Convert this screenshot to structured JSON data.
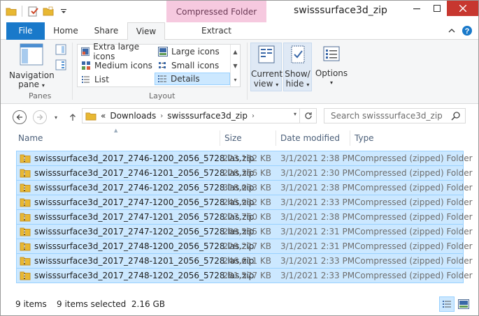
{
  "window": {
    "title": "swisssurface3d_zip",
    "context_tab_header": "Compressed Folder Tools",
    "controls": [
      "minimize-icon",
      "maximize-icon",
      "close-icon"
    ]
  },
  "ribbon_tabs": {
    "file": "File",
    "home": "Home",
    "share": "Share",
    "view": "View",
    "extract": "Extract",
    "active": "View"
  },
  "ribbon": {
    "panes": {
      "navigation_pane_line1": "Navigation",
      "navigation_pane_line2": "pane",
      "group_label": "Panes"
    },
    "layout": {
      "extra_large_icons": "Extra large icons",
      "large_icons": "Large icons",
      "medium_icons": "Medium icons",
      "small_icons": "Small icons",
      "list": "List",
      "details": "Details",
      "selected": "Details",
      "group_label": "Layout"
    },
    "current_view_line1": "Current",
    "current_view_line2": "view",
    "show_hide_line1": "Show/",
    "show_hide_line2": "hide",
    "options": "Options"
  },
  "address": {
    "prefix": "«",
    "crumbs": [
      "Downloads",
      "swisssurface3d_zip"
    ],
    "search_placeholder": "Search swisssurface3d_zip"
  },
  "columns": {
    "name": "Name",
    "size": "Size",
    "date": "Date modified",
    "type": "Type"
  },
  "files": [
    {
      "name": "swisssurface3d_2017_2746-1200_2056_5728.las.zip",
      "size": "223,182 KB",
      "date": "3/1/2021 2:38 PM",
      "type": "Compressed (zipped) Folder"
    },
    {
      "name": "swisssurface3d_2017_2746-1201_2056_5728.las.zip",
      "size": "228,356 KB",
      "date": "3/1/2021 2:30 PM",
      "type": "Compressed (zipped) Folder"
    },
    {
      "name": "swisssurface3d_2017_2746-1202_2056_5728.las.zip",
      "size": "318,033 KB",
      "date": "3/1/2021 2:38 PM",
      "type": "Compressed (zipped) Folder"
    },
    {
      "name": "swisssurface3d_2017_2747-1200_2056_5728.las.zip",
      "size": "245,932 KB",
      "date": "3/1/2021 2:33 PM",
      "type": "Compressed (zipped) Folder"
    },
    {
      "name": "swisssurface3d_2017_2747-1201_2056_5728.las.zip",
      "size": "227,750 KB",
      "date": "3/1/2021 2:38 PM",
      "type": "Compressed (zipped) Folder"
    },
    {
      "name": "swisssurface3d_2017_2747-1202_2056_5728.las.zip",
      "size": "269,585 KB",
      "date": "3/1/2021 2:31 PM",
      "type": "Compressed (zipped) Folder"
    },
    {
      "name": "swisssurface3d_2017_2748-1200_2056_5728.las.zip",
      "size": "229,227 KB",
      "date": "3/1/2021 2:31 PM",
      "type": "Compressed (zipped) Folder"
    },
    {
      "name": "swisssurface3d_2017_2748-1201_2056_5728.las.zip",
      "size": "246,611 KB",
      "date": "3/1/2021 2:33 PM",
      "type": "Compressed (zipped) Folder"
    },
    {
      "name": "swisssurface3d_2017_2748-1202_2056_5728.las.zip",
      "size": "281,577 KB",
      "date": "3/1/2021 2:33 PM",
      "type": "Compressed (zipped) Folder"
    }
  ],
  "status": {
    "item_count": "9 items",
    "selection": "9 items selected  2.16 GB"
  },
  "colors": {
    "file_tab": "#1979ca",
    "context_tab": "#f6c9df",
    "selection_fill": "#cce8ff",
    "selection_border": "#99d1ff",
    "close_button": "#c7372f"
  }
}
